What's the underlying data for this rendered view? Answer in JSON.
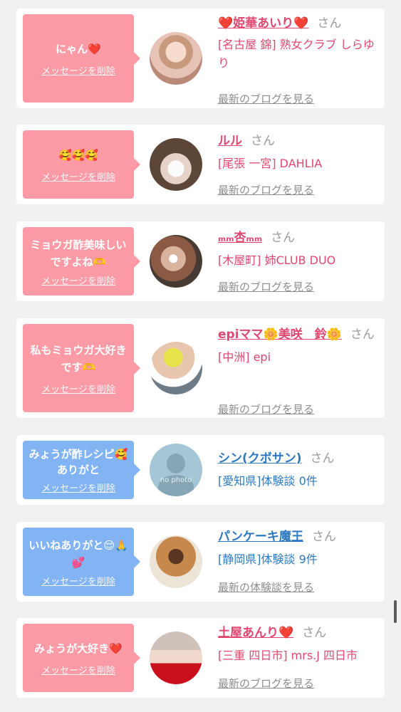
{
  "colors": {
    "pink_bubble": "#fc9ba6",
    "blue_bubble": "#82b4f4",
    "pink_text": "#e04770",
    "blue_text": "#2c79bf",
    "gray_text": "#8d8d8d"
  },
  "delete_label": "メッセージを削除",
  "honorific": "さん",
  "items": [
    {
      "message": "にゃん❤️",
      "name": "❤️姫華あいり❤️",
      "shop": "[名古屋 錦] 熟女クラブ しらゆり",
      "link": "最新のブログを見る"
    },
    {
      "message": "🥰🥰🥰",
      "name": "ルル",
      "shop": "[尾張 一宮] DAHLIA",
      "link": "最新のブログを見る"
    },
    {
      "message": "ミョウガ酢美味しいですよね🫶",
      "name": "ₘₘ杏ₘₘ",
      "shop": "[木屋町] 姉CLUB DUO",
      "link": "最新のブログを見る"
    },
    {
      "message": "私もミョウガ大好きです🫶",
      "name": "epiママ🌼美咲　鈴🌼",
      "shop": "[中洲] epi",
      "link": "最新のブログを見る"
    },
    {
      "message": "みょうが酢レシピ🥰ありがと",
      "name": "シン(クボサン)",
      "shop": "[愛知県]体験談 0件",
      "link": "",
      "avatar_caption": "no photo"
    },
    {
      "message": "いいねありがと😌🙏💕",
      "name": "パンケーキ魔王",
      "shop": "[静岡県]体験談 9件",
      "link": "最新の体験談を見る"
    },
    {
      "message": "みょうが大好き❤️",
      "name": "土屋あんり❤️",
      "shop": "[三重 四日市] mrs.J 四日市",
      "link": "最新のブログを見る"
    }
  ]
}
